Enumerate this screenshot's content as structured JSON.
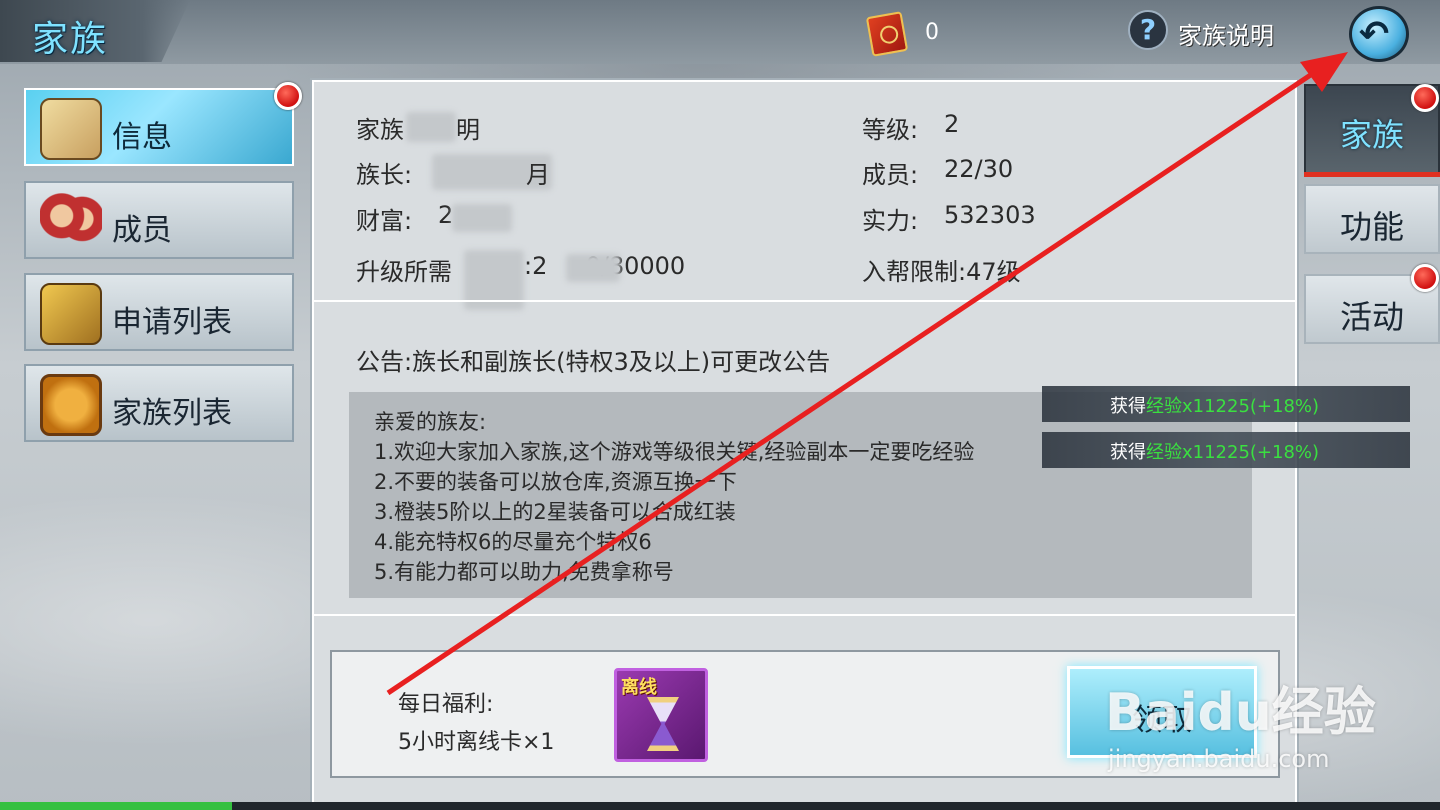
{
  "header": {
    "title": "家族",
    "token_count": "0",
    "help_label": "家族说明"
  },
  "left_tabs": [
    {
      "label": "信息",
      "icon": "scroll-quill-icon",
      "active": true,
      "badge": true
    },
    {
      "label": "成员",
      "icon": "members-icon",
      "active": false,
      "badge": false
    },
    {
      "label": "申请列表",
      "icon": "handshake-icon",
      "active": false,
      "badge": false
    },
    {
      "label": "家族列表",
      "icon": "family-seal-icon",
      "active": false,
      "badge": false
    }
  ],
  "info": {
    "name_label": "家族",
    "name_value_visible": "明",
    "leader_label": "族长:",
    "leader_value_visible": "月",
    "wealth_label": "财富:",
    "wealth_value_visible": "2",
    "upgrade_label": "升级所需",
    "upgrade_value_visible": ":2     0/80000",
    "level_label": "等级:",
    "level_value": "2",
    "members_label": "成员:",
    "members_value": "22/30",
    "power_label": "实力:",
    "power_value": "532303",
    "join_limit": "入帮限制:47级"
  },
  "notice": {
    "title": "公告:族长和副族长(特权3及以上)可更改公告",
    "lines": [
      "亲爱的族友:",
      "1.欢迎大家加入家族,这个游戏等级很关键,经验副本一定要吃经验",
      "2.不要的装备可以放仓库,资源互换一下",
      "3.橙装5阶以上的2星装备可以合成红装",
      "4.能充特权6的尽量充个特权6",
      "5.有能力都可以助力,免费拿称号"
    ]
  },
  "welfare": {
    "label": "每日福利:",
    "reward": "5小时离线卡×1",
    "item_tag": "离线",
    "claim_label": "领取"
  },
  "right_tabs": [
    {
      "label": "家族",
      "active": true,
      "badge": true
    },
    {
      "label": "功能",
      "active": false,
      "badge": false
    },
    {
      "label": "活动",
      "active": false,
      "badge": true
    }
  ],
  "toasts": [
    {
      "prefix": "获得",
      "highlight": "经验",
      "suffix": "x11225(+18%)"
    },
    {
      "prefix": "获得",
      "highlight": "经验",
      "suffix": "x11225(+18%)"
    }
  ],
  "watermark": {
    "logo": "Baidu经验",
    "url": "jingyan.baidu.com"
  },
  "colors": {
    "title_cyan": "#7fe2ff",
    "active_tab": "#5ad0f0",
    "badge_red": "#d01010",
    "annotation_arrow": "#e82020",
    "exp_green": "#3ae040"
  }
}
